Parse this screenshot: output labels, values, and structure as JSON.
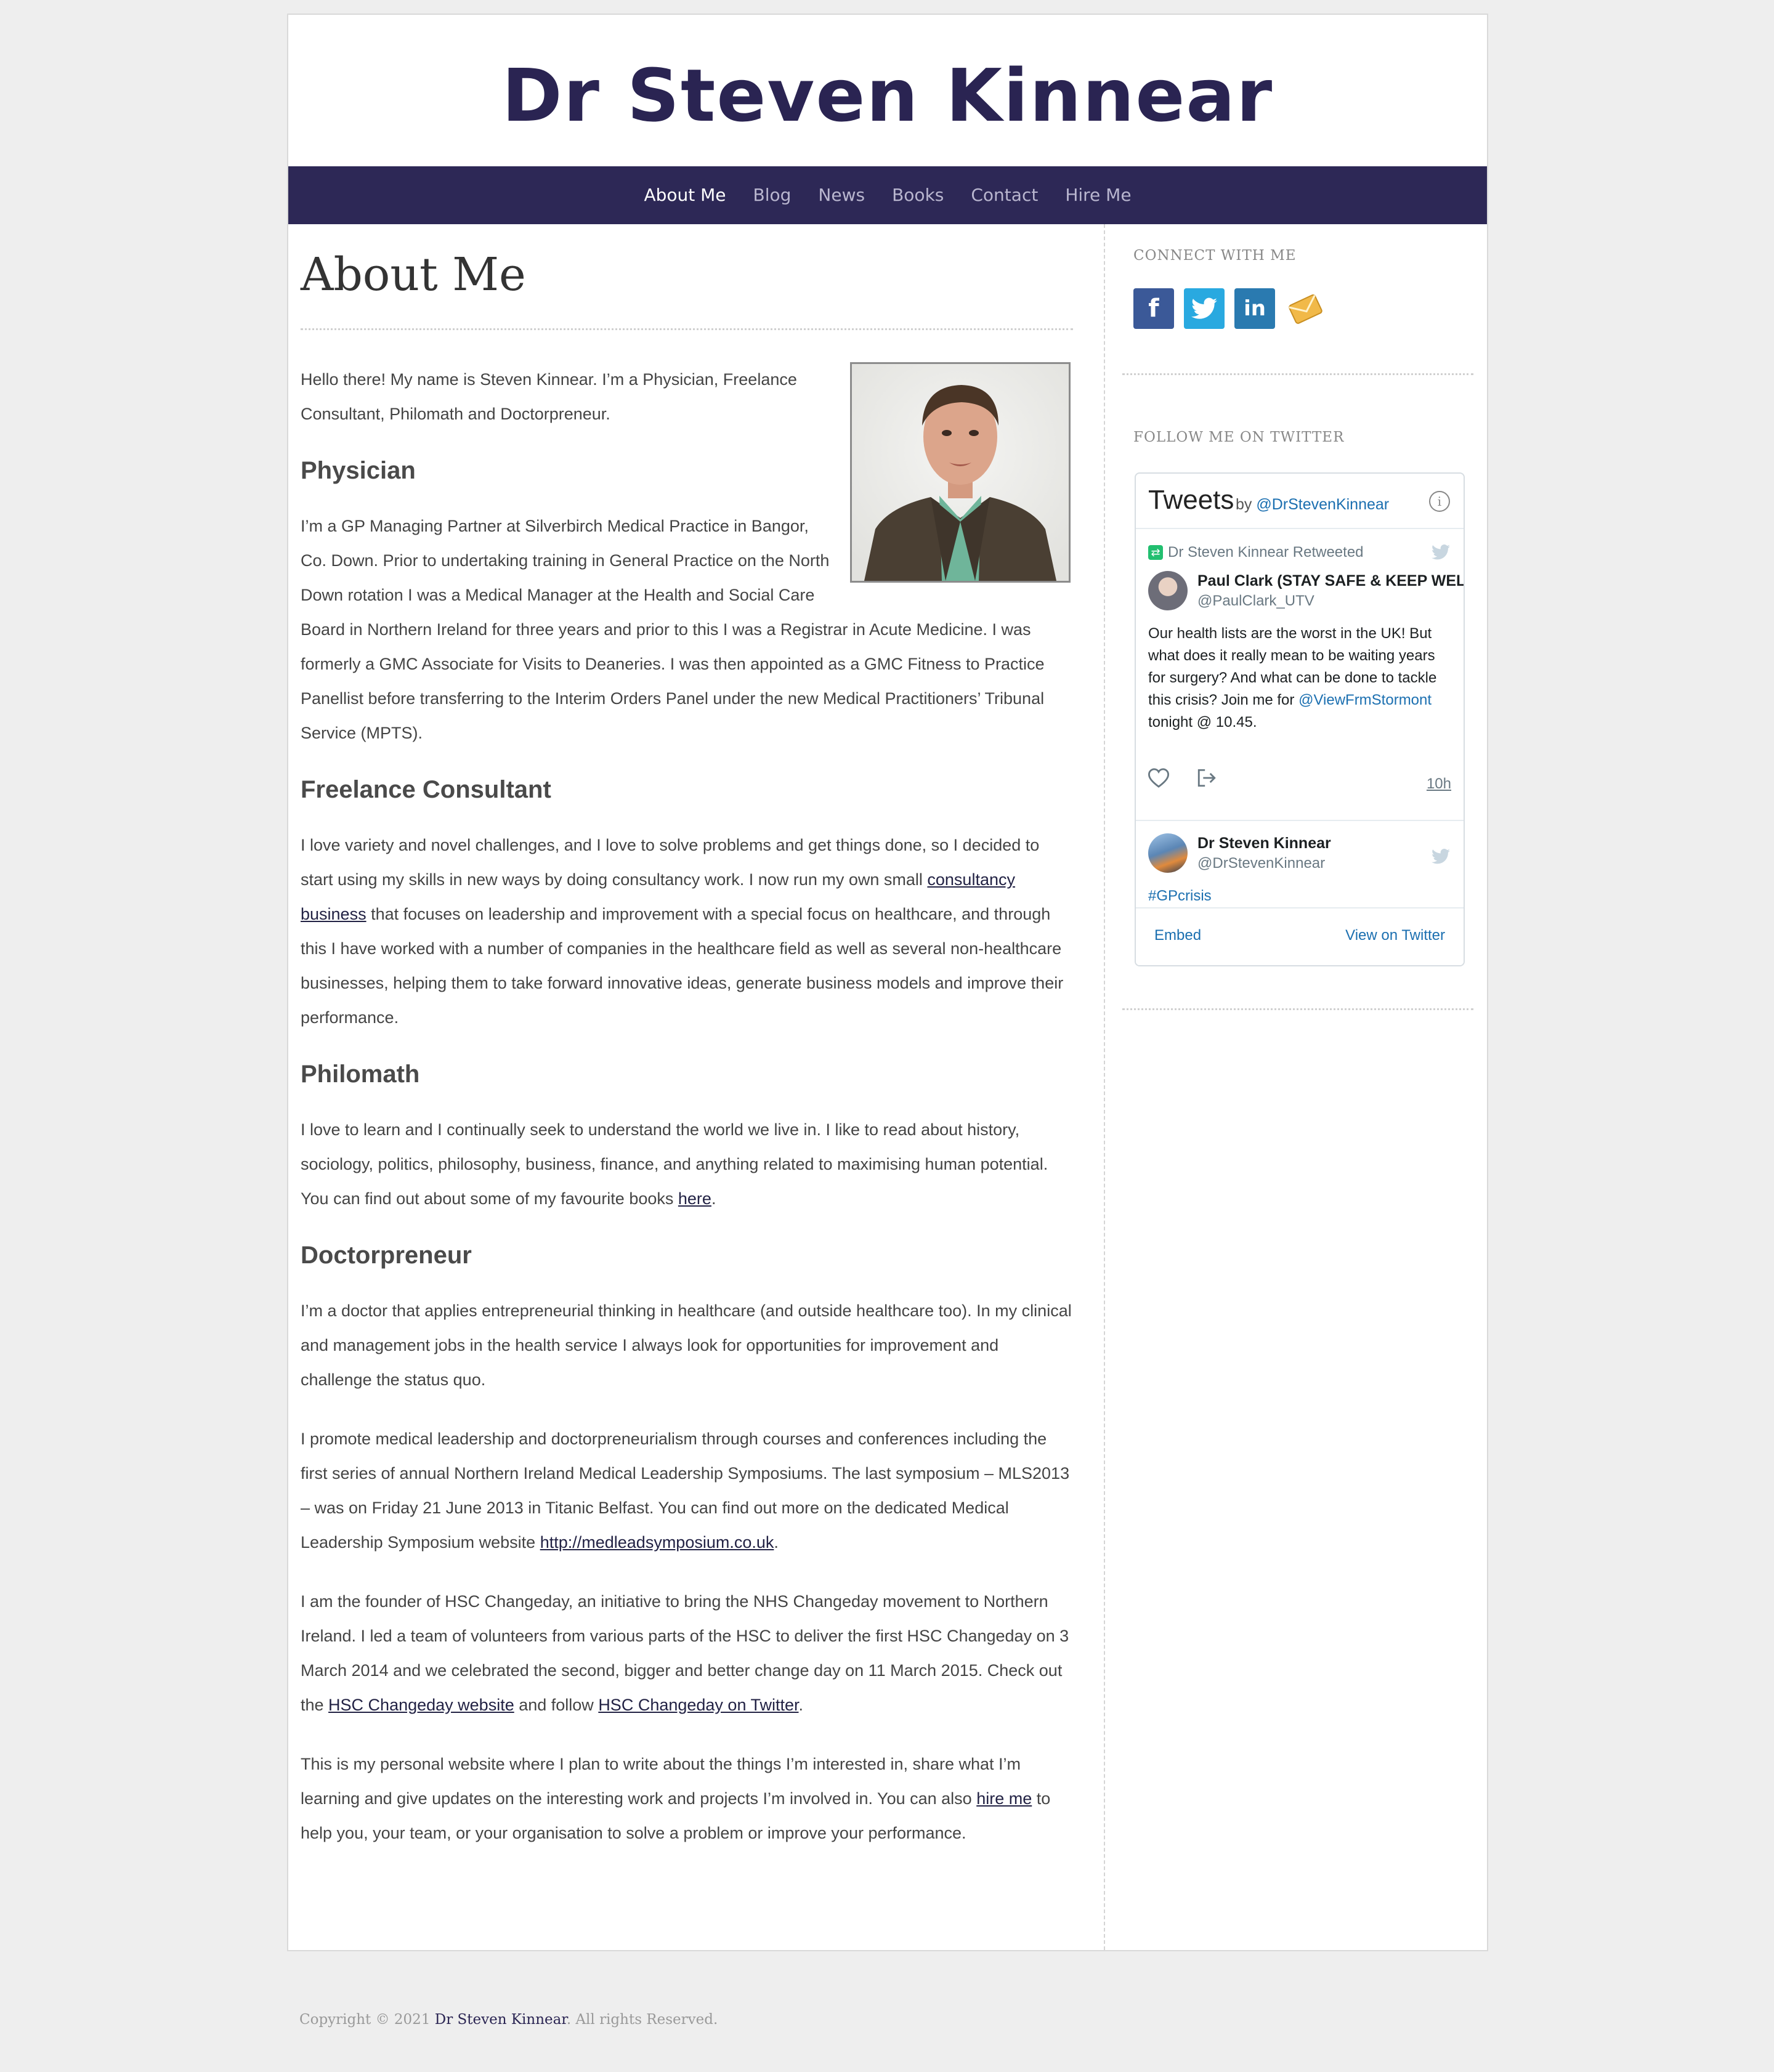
{
  "site": {
    "title": "Dr Steven Kinnear"
  },
  "nav": {
    "items": [
      "About Me",
      "Blog",
      "News",
      "Books",
      "Contact",
      "Hire Me"
    ]
  },
  "page": {
    "title": "About Me",
    "intro": "Hello there! My name is Steven Kinnear. I’m a Physician, Freelance Consultant, Philomath and Doctorpreneur.",
    "physician_heading": "Physician",
    "physician_text": "I’m a GP Managing Partner at Silverbirch Medical Practice in Bangor, Co. Down.  Prior to undertaking training in General Practice on the North Down rotation I was a Medical Manager at the Health and Social Care Board in Northern Ireland for three years and prior to this I was a Registrar in Acute Medicine.  I was formerly a GMC Associate for Visits to Deaneries.  I was then appointed as a GMC Fitness to Practice Panellist  before transferring to the Interim Orders Panel under the new Medical Practitioners’ Tribunal Service (MPTS).",
    "freelance_heading": "Freelance Consultant",
    "freelance_before": "I love variety and novel challenges, and I love to solve problems and get things done, so I decided to start using my skills in new ways by doing consultancy work.  I now run my own small ",
    "freelance_link": "consultancy business",
    "freelance_after": " that focuses on leadership and improvement with a special focus on healthcare, and through this I have worked with a number of  companies in the healthcare field as well as several non-healthcare businesses, helping them to take forward innovative ideas, generate business models and improve their performance.",
    "philomath_heading": "Philomath",
    "philomath_before": "I love to learn and I continually seek to understand the world we live in. I like to read about history, sociology, politics, philosophy, business, finance, and anything related to maximising human potential.  You can find out about some of my favourite books ",
    "philomath_link": "here",
    "philomath_after": ".",
    "doctorpreneur_heading": "Doctorpreneur",
    "doctorpreneur_p1": "I’m a doctor that applies entrepreneurial thinking in healthcare (and outside healthcare too). In my clinical and management jobs in the health service I always look for opportunities for improvement and challenge the status quo.",
    "doctorpreneur_p2_before": "I promote medical leadership and doctorpreneurialism through courses and conferences including the first series of annual Northern Ireland Medical Leadership Symposiums.  The last symposium – MLS2013 – was on Friday 21 June 2013 in Titanic Belfast. You can find out more on the dedicated Medical Leadership Symposium website ",
    "doctorpreneur_p2_link": "http://medleadsymposium.co.uk",
    "doctorpreneur_p2_after": ".",
    "changeday_before": "I am the founder of HSC Changeday, an initiative to bring the NHS Changeday movement to Northern Ireland.  I led a team of volunteers from various parts of the HSC to deliver the first HSC Changeday on 3 March 2014 and we celebrated the second, bigger and better change day on 11 March 2015.  Check out the ",
    "changeday_link1": "HSC Changeday website",
    "changeday_mid": " and follow ",
    "changeday_link2": "HSC Changeday on Twitter",
    "changeday_after": ".",
    "personal_before": "This is my personal website where I plan to write about the things I’m interested in, share what I’m learning and give updates on the interesting work and projects I’m involved in. You can also ",
    "personal_link": "hire me",
    "personal_after": " to help you, your team, or your organisation to solve a problem or improve your performance."
  },
  "sidebar": {
    "connect_title": "CONNECT WITH ME",
    "social_icons": [
      "facebook-icon",
      "twitter-icon",
      "linkedin-icon",
      "email-icon"
    ],
    "twitter_title": "FOLLOW ME ON TWITTER",
    "timeline": {
      "heading": "Tweets",
      "by": "by",
      "handle": "@DrStevenKinnear",
      "tweet1": {
        "retweet_label": "Dr Steven Kinnear Retweeted",
        "name": "Paul Clark (STAY SAFE & KEEP WEL",
        "handle": "@PaulClark_UTV",
        "text_before": "Our health lists are the worst in the UK!  But what does it really mean to be waiting years for surgery?  And what can be done to tackle this crisis?  Join me for ",
        "mention": "@ViewFrmStormont",
        "text_after": " tonight @ 10.45.",
        "time": "10h"
      },
      "tweet2": {
        "name": "Dr Steven Kinnear",
        "handle": "@DrStevenKinnear",
        "hashtag": "#GPcrisis"
      },
      "embed": "Embed",
      "view": "View on Twitter"
    }
  },
  "footer": {
    "prefix": "Copyright © 2021 ",
    "owner": "Dr Steven Kinnear",
    "suffix": ". All rights Reserved."
  },
  "colors": {
    "brand": "#2d2856",
    "title": "#2a2452",
    "background": "#eeeeee"
  }
}
